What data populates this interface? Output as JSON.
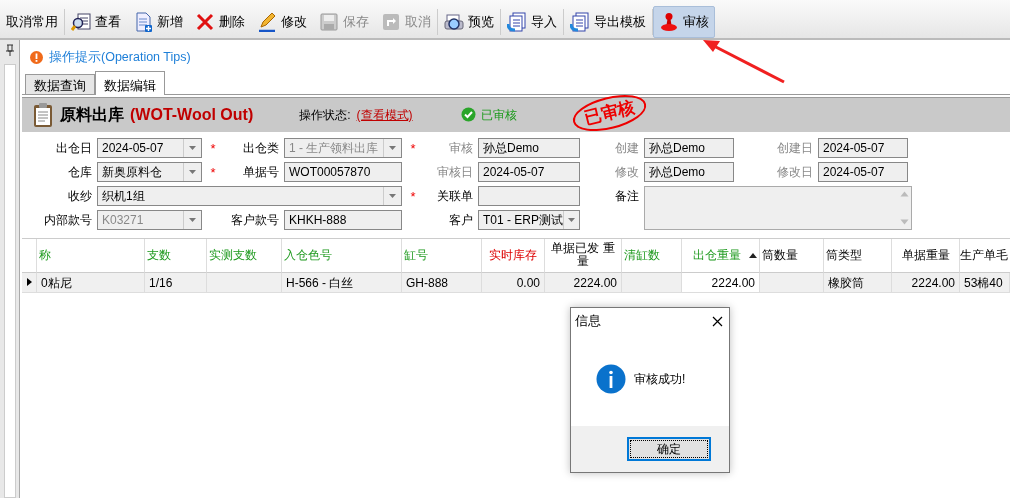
{
  "toolbar": [
    {
      "label": "取消常用",
      "kind": "none",
      "disabled": false,
      "selected": false
    },
    {
      "label": "查看",
      "kind": "view",
      "disabled": false,
      "selected": false
    },
    {
      "label": "新增",
      "kind": "new",
      "disabled": false,
      "selected": false
    },
    {
      "label": "删除",
      "kind": "delete",
      "disabled": false,
      "selected": false
    },
    {
      "label": "修改",
      "kind": "edit",
      "disabled": false,
      "selected": false
    },
    {
      "label": "保存",
      "kind": "save",
      "disabled": true,
      "selected": false
    },
    {
      "label": "取消",
      "kind": "undo",
      "disabled": true,
      "selected": false
    },
    {
      "label": "预览",
      "kind": "preview",
      "disabled": false,
      "selected": false
    },
    {
      "label": "导入",
      "kind": "import",
      "disabled": false,
      "selected": false
    },
    {
      "label": "导出模板",
      "kind": "import",
      "disabled": false,
      "selected": false
    },
    {
      "label": "审核",
      "kind": "audit",
      "disabled": false,
      "selected": true
    }
  ],
  "tips": "操作提示(Operation Tips)",
  "tabs": [
    {
      "label": "数据查询",
      "selected": false
    },
    {
      "label": "数据编辑",
      "selected": true
    }
  ],
  "header": {
    "title": "原料出库",
    "code": "(WOT-Wool Out)",
    "state_label": "操作状态:",
    "mode": "(查看模式)",
    "status": "已审核",
    "stamp": "已审核"
  },
  "form": [
    {
      "label": "出仓日",
      "value": "2024-05-07",
      "kind": "combo",
      "mark": "*",
      "readonly": false,
      "disabled": false
    },
    {
      "label": "出仓类",
      "value": "1 - 生产领料出库",
      "kind": "combo",
      "mark": "*",
      "readonly": false,
      "disabled": true
    },
    {
      "label": "审核",
      "value": "孙总Demo",
      "kind": "text",
      "readonly": true,
      "disabled": false
    },
    {
      "label": "创建",
      "value": "孙总Demo",
      "kind": "text",
      "readonly": true,
      "disabled": false
    },
    {
      "label": "创建日",
      "value": "2024-05-07",
      "kind": "text",
      "readonly": true,
      "disabled": false
    },
    {
      "label": "仓库",
      "value": "新奥原料仓",
      "kind": "combo",
      "mark": "*",
      "readonly": false,
      "disabled": false
    },
    {
      "label": "单据号",
      "value": "WOT00057870",
      "kind": "text",
      "readonly": false,
      "disabled": false
    },
    {
      "label": "审核日",
      "value": "2024-05-07",
      "kind": "text",
      "readonly": true,
      "disabled": false
    },
    {
      "label": "修改",
      "value": "孙总Demo",
      "kind": "text",
      "readonly": true,
      "disabled": false
    },
    {
      "label": "修改日",
      "value": "2024-05-07",
      "kind": "text",
      "readonly": true,
      "disabled": false
    },
    {
      "label": "收纱",
      "value": "织机1组",
      "kind": "wide",
      "mark": "*",
      "readonly": false,
      "disabled": false
    },
    {
      "label": "关联单",
      "kind": "text",
      "readonly": false
    },
    {
      "label": "备注",
      "kind": "memo",
      "readonly": false
    },
    {
      "label": "内部款号",
      "value": "K03271",
      "kind": "combo",
      "readonly": false,
      "disabled": true
    },
    {
      "label": "客户款号",
      "value": "KHKH-888",
      "kind": "text",
      "readonly": false,
      "disabled": false
    },
    {
      "label": "客户",
      "value": "T01 - ERP测试",
      "kind": "combo",
      "readonly": false,
      "disabled": false
    }
  ],
  "table": {
    "columns": [
      {
        "label": "称",
        "kind": "required",
        "numeric": false,
        "sorted": false,
        "current": false
      },
      {
        "label": "支数",
        "kind": "required",
        "numeric": false,
        "sorted": false,
        "current": false
      },
      {
        "label": "实测支数",
        "kind": "required",
        "numeric": false,
        "sorted": false
      },
      {
        "label": "入仓色号",
        "kind": "required",
        "numeric": false,
        "sorted": false,
        "current": false
      },
      {
        "label": "缸号",
        "kind": "required",
        "numeric": false,
        "sorted": false,
        "current": false
      },
      {
        "label": "实时库存",
        "kind": "warning",
        "numeric": true,
        "sorted": false,
        "current": false
      },
      {
        "label": "单据已发 重量",
        "kind": "normal",
        "numeric": true,
        "sorted": false,
        "current": false
      },
      {
        "label": "清缸数",
        "kind": "required",
        "numeric": false,
        "sorted": false
      },
      {
        "label": "出仓重量",
        "kind": "required",
        "numeric": true,
        "sorted": true,
        "current": true
      },
      {
        "label": "筒数量",
        "kind": "normal",
        "numeric": false,
        "sorted": false
      },
      {
        "label": "筒类型",
        "kind": "normal",
        "numeric": false,
        "sorted": false,
        "current": false
      },
      {
        "label": "单据重量",
        "kind": "normal",
        "numeric": true,
        "sorted": false,
        "current": false
      },
      {
        "label": "生产单毛",
        "kind": "normal",
        "numeric": false,
        "sorted": false,
        "current": false
      }
    ],
    "rows": [
      {
        "current": true,
        "cells": [
          "0粘尼",
          "1/16",
          null,
          "H-566 - 白丝",
          "GH-888",
          "0.00",
          "2224.00",
          null,
          "2224.00",
          null,
          "橡胶筒",
          "2224.00",
          "53棉40"
        ]
      }
    ]
  },
  "dialog": {
    "title": "信息",
    "message": "审核成功!",
    "button": "确定"
  }
}
